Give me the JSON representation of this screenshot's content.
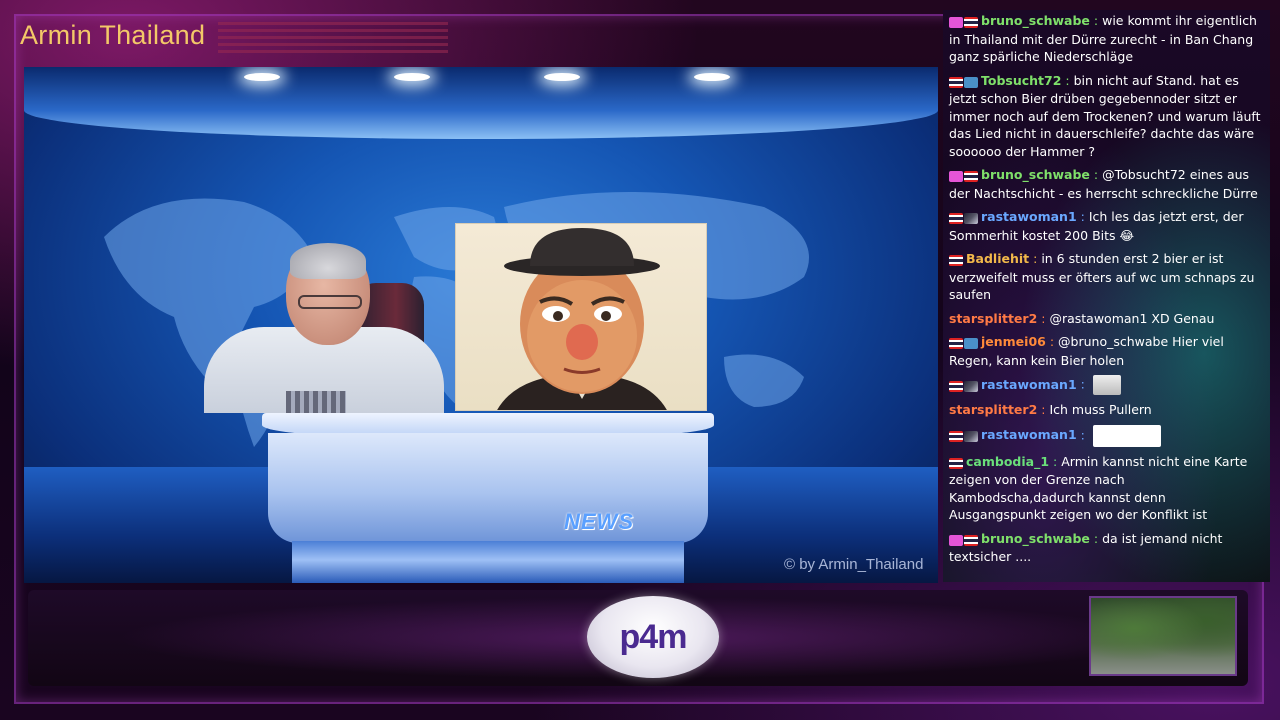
{
  "overlay": {
    "channel_title": "Armin Thailand",
    "copyright": "© by Armin_Thailand",
    "desk_label": "NEWS",
    "logo_text": "p4m",
    "colors": {
      "title": "#f3c868",
      "frame": "#aa3cc8",
      "desk_label": "#5aa0ff"
    }
  },
  "chat": {
    "messages": [
      {
        "badges": [
          "heart-badge",
          "thai-flag-badge"
        ],
        "user": "bruno_schwabe",
        "user_color": "#7fe06a",
        "text": "wie kommt ihr eigentlich in Thailand mit der Dürre zurecht - in Ban Chang ganz spärliche Niederschläge"
      },
      {
        "badges": [
          "thai-flag-badge",
          "crown-badge"
        ],
        "user": "Tobsucht72",
        "user_color": "#7fe06a",
        "text": "bin nicht auf Stand. hat es jetzt schon Bier drüben gegebennoder sitzt er immer noch auf dem Trockenen? und warum läuft das Lied nicht in dauerschleife? dachte das wäre soooooo der Hammer ?"
      },
      {
        "badges": [
          "heart-badge",
          "thai-flag-badge"
        ],
        "user": "bruno_schwabe",
        "user_color": "#7fe06a",
        "text": "@Tobsucht72 eines aus der Nachtschicht - es herrscht schreckliche Dürre"
      },
      {
        "badges": [
          "thai-flag-badge",
          "bits-badge"
        ],
        "user": "rastawoman1",
        "user_color": "#6aa8ff",
        "text": "Ich les das jetzt erst, der Sommerhit kostet 200 Bits 😂"
      },
      {
        "badges": [
          "thai-flag-badge"
        ],
        "user": "Badliehit",
        "user_color": "#f2b84a",
        "text": "in 6 stunden erst 2 bier er ist verzweifelt muss er öfters auf wc um schnaps zu saufen"
      },
      {
        "badges": [],
        "user": "starsplitter2",
        "user_color": "#ff7a45",
        "text": "@rastawoman1 XD Genau"
      },
      {
        "badges": [
          "thai-flag-badge",
          "crown-badge"
        ],
        "user": "jenmei06",
        "user_color": "#ff8a3a",
        "text": "@bruno_schwabe Hier viel Regen, kann kein Bier holen"
      },
      {
        "badges": [
          "thai-flag-badge",
          "bits-badge"
        ],
        "user": "rastawoman1",
        "user_color": "#6aa8ff",
        "text": "",
        "emote": "triangle-emote"
      },
      {
        "badges": [],
        "user": "starsplitter2",
        "user_color": "#ff7a45",
        "text": "Ich muss Pullern"
      },
      {
        "badges": [
          "thai-flag-badge",
          "bits-badge"
        ],
        "user": "rastawoman1",
        "user_color": "#6aa8ff",
        "text": "",
        "emote": "penguins-emote"
      },
      {
        "badges": [
          "thai-flag-badge"
        ],
        "user": "cambodia_1",
        "user_color": "#6adf7a",
        "text": "Armin kannst nicht eine Karte zeigen von der Grenze nach Kambodscha,dadurch kannst denn Ausgangspunkt zeigen wo der Konflikt ist"
      },
      {
        "badges": [
          "heart-badge",
          "thai-flag-badge"
        ],
        "user": "bruno_schwabe",
        "user_color": "#7fe06a",
        "text": "da ist jemand nicht textsicher ...."
      }
    ]
  }
}
